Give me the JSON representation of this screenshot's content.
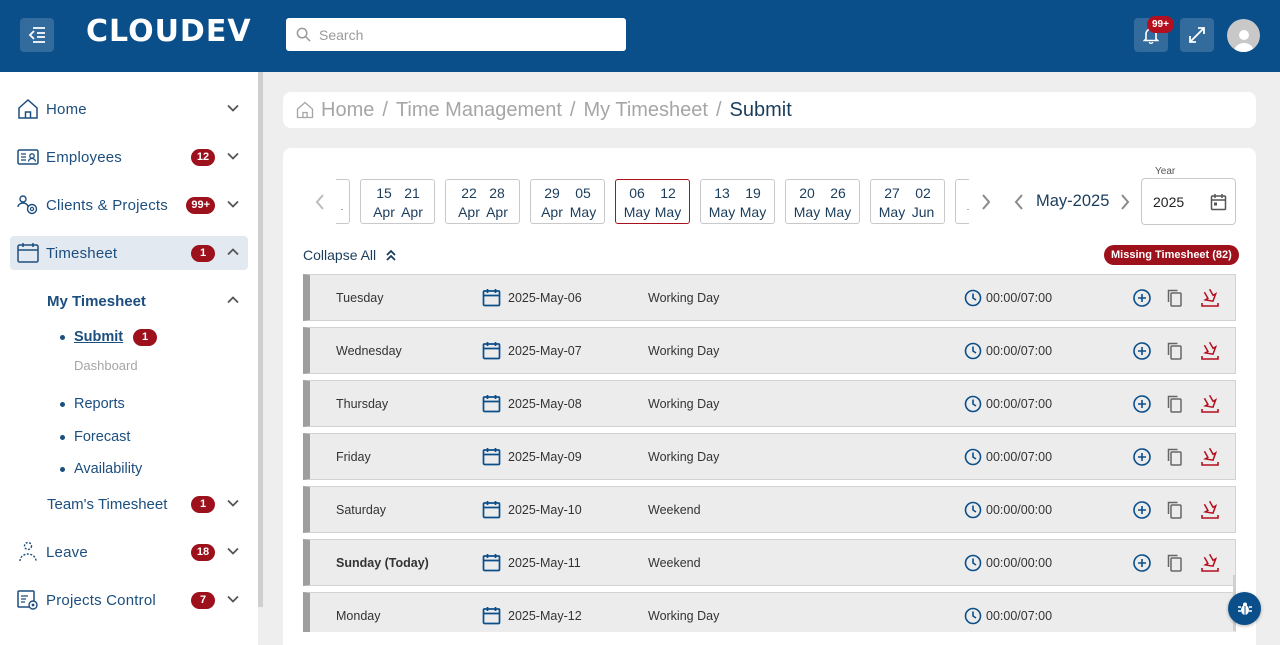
{
  "header": {
    "logo": "CLOUDEV",
    "search_placeholder": "Search",
    "notification_count": "99+"
  },
  "sidebar": {
    "items": [
      {
        "label": "Home",
        "badge": ""
      },
      {
        "label": "Employees",
        "badge": "12"
      },
      {
        "label": "Clients & Projects",
        "badge": "99+"
      },
      {
        "label": "Timesheet",
        "badge": "1"
      },
      {
        "label": "Leave",
        "badge": "18"
      },
      {
        "label": "Projects Control",
        "badge": "7"
      }
    ],
    "my_timesheet": "My Timesheet",
    "submit": {
      "label": "Submit",
      "badge": "1"
    },
    "dashboard": "Dashboard",
    "reports": "Reports",
    "forecast": "Forecast",
    "availability": "Availability",
    "teams_timesheet": {
      "label": "Team's Timesheet",
      "badge": "1"
    }
  },
  "breadcrumb": [
    "Home",
    "Time Management",
    "My Timesheet",
    "Submit"
  ],
  "weeks": [
    {
      "start_day": "15",
      "start_month": "Apr",
      "end_day": "21",
      "end_month": "Apr"
    },
    {
      "start_day": "22",
      "start_month": "Apr",
      "end_day": "28",
      "end_month": "Apr"
    },
    {
      "start_day": "29",
      "start_month": "Apr",
      "end_day": "05",
      "end_month": "May"
    },
    {
      "start_day": "06",
      "start_month": "May",
      "end_day": "12",
      "end_month": "May"
    },
    {
      "start_day": "13",
      "start_month": "May",
      "end_day": "19",
      "end_month": "May"
    },
    {
      "start_day": "20",
      "start_month": "May",
      "end_day": "26",
      "end_month": "May"
    },
    {
      "start_day": "27",
      "start_month": "May",
      "end_day": "02",
      "end_month": "Jun"
    }
  ],
  "month_label": "May-2025",
  "year": {
    "legend": "Year",
    "value": "2025"
  },
  "collapse_all": "Collapse All",
  "missing_timesheet": "Missing Timesheet (82)",
  "days": [
    {
      "day": "Tuesday",
      "date": "2025-May-06",
      "type": "Working Day",
      "hours": "00:00/07:00"
    },
    {
      "day": "Wednesday",
      "date": "2025-May-07",
      "type": "Working Day",
      "hours": "00:00/07:00"
    },
    {
      "day": "Thursday",
      "date": "2025-May-08",
      "type": "Working Day",
      "hours": "00:00/07:00"
    },
    {
      "day": "Friday",
      "date": "2025-May-09",
      "type": "Working Day",
      "hours": "00:00/07:00"
    },
    {
      "day": "Saturday",
      "date": "2025-May-10",
      "type": "Weekend",
      "hours": "00:00/00:00"
    },
    {
      "day": "Sunday  (Today)",
      "date": "2025-May-11",
      "type": "Weekend",
      "hours": "00:00/00:00"
    },
    {
      "day": "Monday",
      "date": "2025-May-12",
      "type": "Working Day",
      "hours": "00:00/07:00"
    }
  ],
  "colors": {
    "primary": "#0b4f8a",
    "accent_red": "#9c111b",
    "nav_text": "#1c4e7e"
  }
}
